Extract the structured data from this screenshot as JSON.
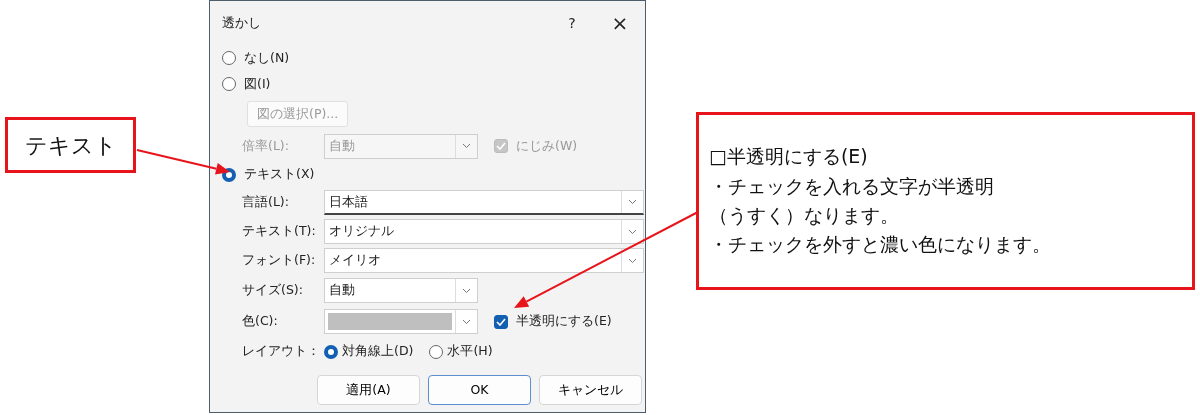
{
  "dialog": {
    "title": "透かし",
    "help_button": "?",
    "close_button": "×",
    "source_options": [
      {
        "label": "なし(N)",
        "selected": false
      },
      {
        "label": "図(I)",
        "selected": false
      },
      {
        "label": "テキスト(X)",
        "selected": true
      }
    ],
    "picture": {
      "disabled": true,
      "select_button": "図の選択(P)...",
      "scale_label": "倍率(L):",
      "scale_value": "自動",
      "blur": {
        "label": "にじみ(W)",
        "checked": true
      }
    },
    "text_fields": [
      {
        "kind": "wide",
        "label": "言語(L):",
        "value": "日本語",
        "focused": true
      },
      {
        "kind": "wide",
        "label": "テキスト(T):",
        "value": "オリジナル",
        "focused": false
      },
      {
        "kind": "wide",
        "label": "フォント(F):",
        "value": "メイリオ",
        "focused": false
      },
      {
        "kind": "short",
        "label": "サイズ(S):",
        "value": "自動",
        "focused": false
      },
      {
        "kind": "color",
        "label": "色(C):",
        "focused": false
      }
    ],
    "translucent": {
      "label": "半透明にする(E)",
      "checked": true
    },
    "layout_label": "レイアウト：",
    "layout_options": [
      {
        "label": "対角線上(D)",
        "selected": true
      },
      {
        "label": "水平(H)",
        "selected": false
      }
    ],
    "buttons": [
      {
        "label": "適用(A)",
        "default": false
      },
      {
        "label": "OK",
        "default": true
      },
      {
        "label": "キャンセル",
        "default": false
      }
    ]
  },
  "callouts": [
    {
      "lines": [
        "テキスト"
      ]
    },
    {
      "lines": [
        "□半透明にする(E)",
        "・チェックを入れる文字が半透明",
        "（うすく）なります。",
        "・チェックを外すと濃い色になります。"
      ]
    }
  ]
}
